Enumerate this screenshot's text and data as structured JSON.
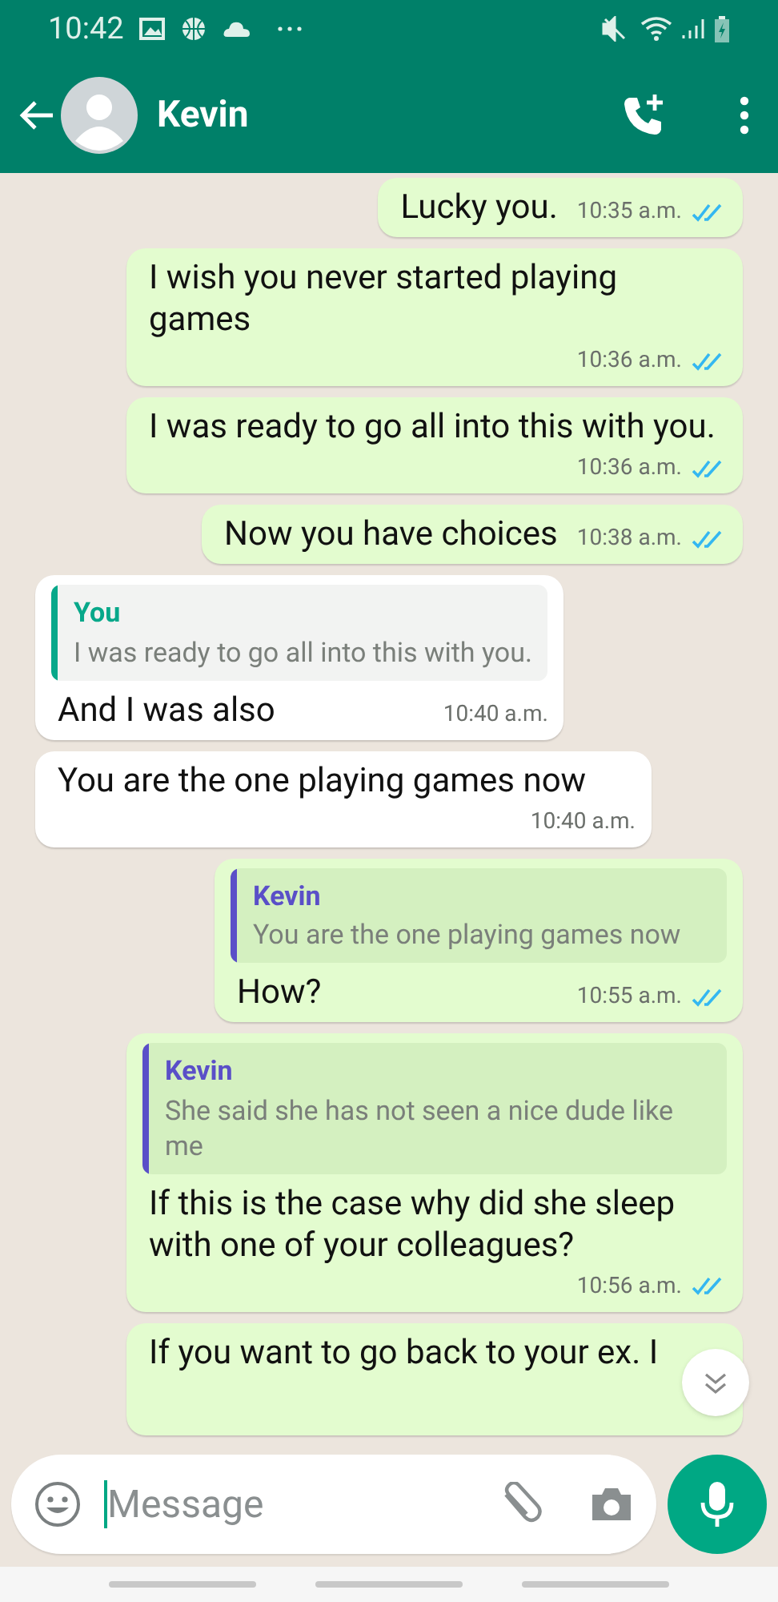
{
  "status_bar": {
    "time": "10:42"
  },
  "header": {
    "contact": "Kevin"
  },
  "messages": [
    {
      "kind": "out",
      "text": "Lucky you.",
      "time": "10:35 a.m.",
      "read": true
    },
    {
      "kind": "out",
      "text": "I wish you never started playing games",
      "time": "10:36 a.m.",
      "read": true
    },
    {
      "kind": "out",
      "text": "I was ready to go all into this with you.",
      "time": "10:36 a.m.",
      "read": true
    },
    {
      "kind": "out",
      "text": "Now you have choices",
      "time": "10:38 a.m.",
      "read": true
    },
    {
      "kind": "in",
      "quote": {
        "author": "You",
        "text": "I was ready to go all into this with you.",
        "color": "#07a88a"
      },
      "text": "And I was also",
      "time": "10:40 a.m."
    },
    {
      "kind": "in",
      "text": "You are the one playing games now",
      "time": "10:40 a.m."
    },
    {
      "kind": "out",
      "quote": {
        "author": "Kevin",
        "text": "You are the one playing games now",
        "color": "#5a4fc8"
      },
      "text": "How?",
      "time": "10:55 a.m.",
      "read": true
    },
    {
      "kind": "out",
      "quote": {
        "author": "Kevin",
        "text": "She said she has not seen a nice dude like me",
        "color": "#5a4fc8"
      },
      "text": "If this is the case why did she sleep with one of your colleagues?",
      "time": "10:56 a.m.",
      "read": true
    },
    {
      "kind": "out",
      "text": "If you want to go back to your ex.  I"
    }
  ],
  "composer": {
    "placeholder": "Message"
  }
}
